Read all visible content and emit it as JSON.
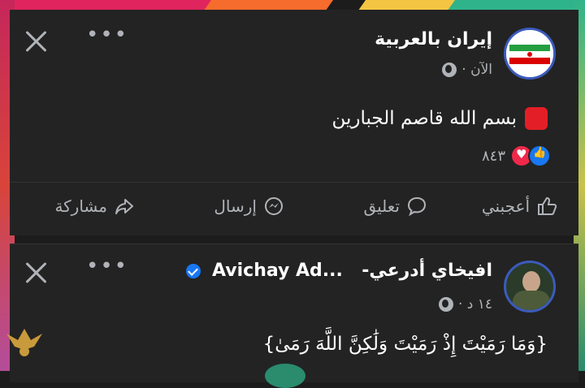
{
  "post1": {
    "page_name": "إيران بالعربية",
    "timestamp": "الآن ·",
    "text": "بسم الله قاصم الجبارين",
    "reaction_count": "٨٤٣",
    "actions": {
      "like": "أعجبني",
      "comment": "تعليق",
      "send": "إرسال",
      "share": "مشاركة"
    }
  },
  "post2": {
    "page_name_ar": "افيخاي أدرعي-",
    "page_name_en": "Avichay Ad...",
    "timestamp": "١٤ د ·",
    "text": "{وَمَا رَمَيْتَ إِذْ رَمَيْتَ وَلَٰكِنَّ اللَّهَ رَمَىٰ}"
  },
  "icons": {
    "close": "close-icon",
    "more": "more-icon",
    "globe": "globe-icon",
    "like": "thumbs-up-icon",
    "comment": "comment-bubble-icon",
    "send": "messenger-icon",
    "share": "share-arrow-icon"
  },
  "colors": {
    "background": "#1c1c1c",
    "card": "#232323",
    "accent": "#1877f2",
    "love": "#f0284a",
    "text_primary": "#ffffff",
    "text_secondary": "#b0b3b8"
  }
}
